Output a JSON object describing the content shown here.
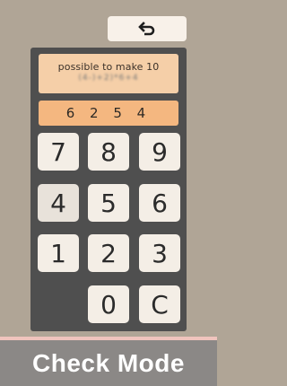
{
  "back_button": {
    "icon": "undo-arrow-icon"
  },
  "hint": {
    "title": "possible to make 10",
    "detail": "(4-)+2)*6+4"
  },
  "display": {
    "value": "6 2 5 4"
  },
  "keypad": {
    "keys": [
      "7",
      "8",
      "9",
      "4",
      "5",
      "6",
      "1",
      "2",
      "3",
      "0",
      "C"
    ]
  },
  "mode_button": {
    "label": "Check Mode"
  }
}
